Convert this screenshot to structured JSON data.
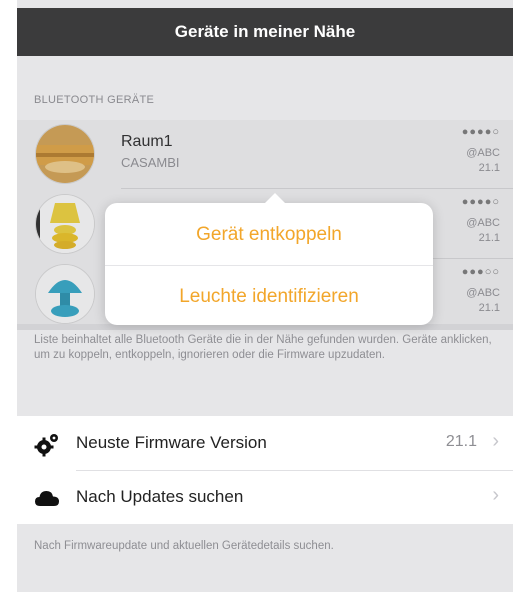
{
  "nav": {
    "title": "Geräte in meiner Nähe"
  },
  "bluetooth": {
    "header": "BLUETOOTH GERÄTE",
    "devices": [
      {
        "name": "Raum1",
        "maker": "CASAMBI",
        "signal": "●●●●○",
        "brand": "@ABC",
        "version": "21.1",
        "icon": "pendant-lamp-icon"
      },
      {
        "name": "",
        "maker": "",
        "signal": "●●●●○",
        "brand": "@ABC",
        "version": "21.1",
        "icon": "table-lamp-icon"
      },
      {
        "name": "",
        "maker": "",
        "signal": "●●●○○",
        "brand": "@ABC",
        "version": "21.1",
        "icon": "mushroom-lamp-icon"
      }
    ],
    "footer": "Liste beinhaltet alle Bluetooth Geräte die in der Nähe gefunden wurden. Geräte anklicken, um zu koppeln, entkoppeln, ignorieren oder die Firmware upzudaten."
  },
  "action_sheet": {
    "items": [
      {
        "label": "Gerät entkoppeln"
      },
      {
        "label": "Leuchte identifizieren"
      }
    ]
  },
  "settings": {
    "items": [
      {
        "label": "Neuste Firmware Version",
        "value": "21.1",
        "icon": "gear-icon"
      },
      {
        "label": "Nach Updates suchen",
        "value": "",
        "icon": "cloud-icon"
      }
    ],
    "note": "Nach Firmwareupdate und aktuellen Gerätedetails suchen."
  },
  "colors": {
    "accent": "#f2a62a",
    "navbar": "#3b3b3c",
    "background": "#e6e6e8"
  }
}
